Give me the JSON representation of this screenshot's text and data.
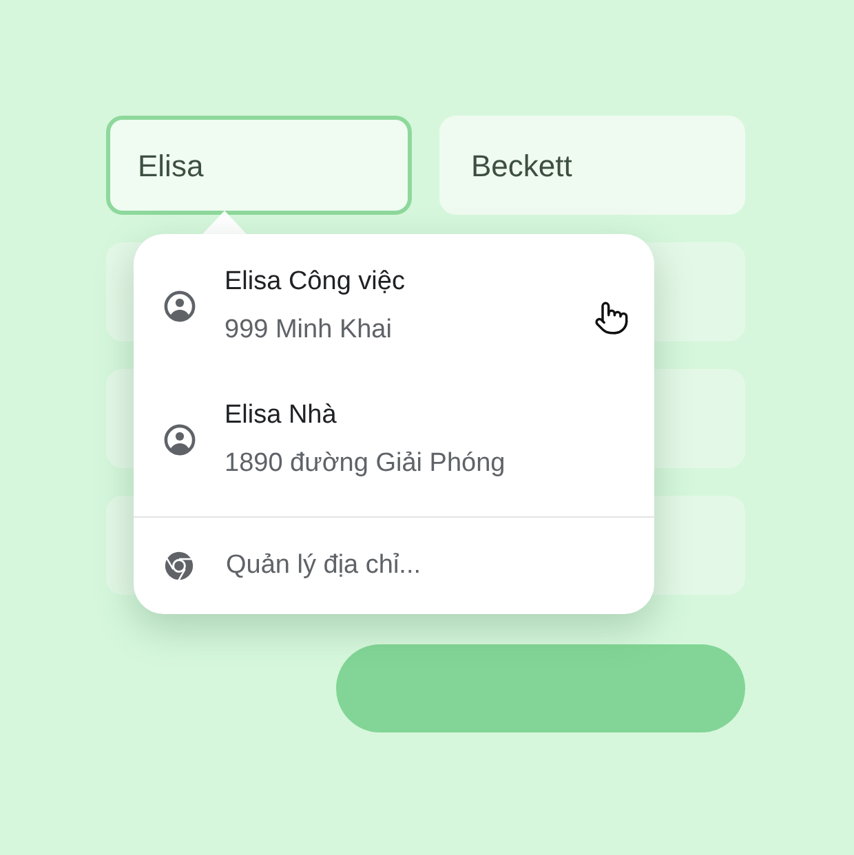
{
  "fields": [
    {
      "value": "Elisa",
      "focused": true
    },
    {
      "value": "Beckett",
      "focused": false
    },
    {
      "focused": false
    },
    {
      "focused": false
    },
    {
      "focused": false
    },
    {
      "focused": false
    },
    {
      "focused": false
    },
    {
      "focused": false
    }
  ],
  "suggestions": [
    {
      "kind": "address",
      "title": "Elisa Công việc",
      "subtitle": "999 Minh Khai"
    },
    {
      "kind": "address",
      "title": "Elisa Nhà",
      "subtitle": "1890 đường Giải Phóng"
    },
    {
      "kind": "manage",
      "title": "Quản lý địa chỉ..."
    }
  ]
}
